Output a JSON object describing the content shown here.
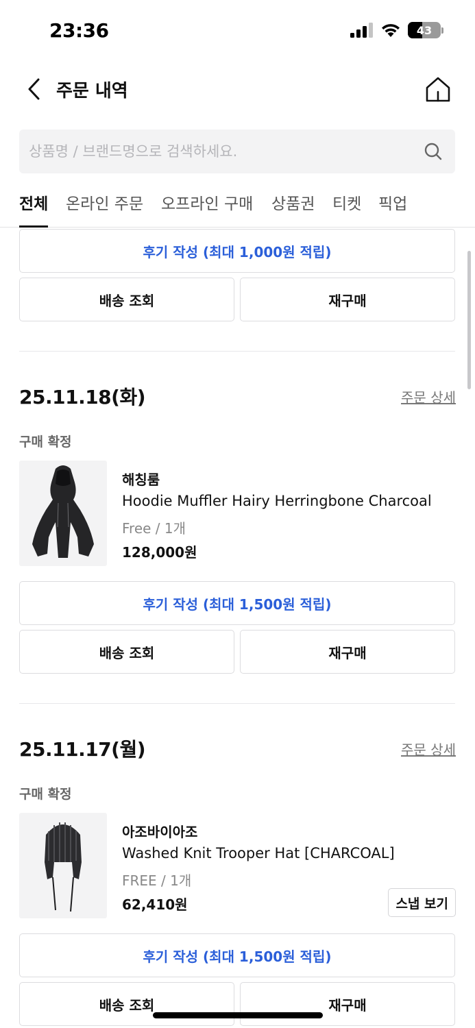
{
  "status_bar": {
    "time": "23:36",
    "battery": "43"
  },
  "header": {
    "title": "주문 내역"
  },
  "search": {
    "placeholder": "상품명 / 브랜드명으로 검색하세요."
  },
  "tabs": [
    {
      "label": "전체",
      "active": true
    },
    {
      "label": "온라인 주문",
      "active": false
    },
    {
      "label": "오프라인 구매",
      "active": false
    },
    {
      "label": "상품권",
      "active": false
    },
    {
      "label": "티켓",
      "active": false
    },
    {
      "label": "픽업",
      "active": false
    }
  ],
  "top_partial": {
    "review_label": "후기 작성 (최대 1,000원 적립)",
    "delivery_label": "배송 조회",
    "rebuy_label": "재구매"
  },
  "orders": [
    {
      "date": "25.11.18(화)",
      "detail_link": "주문 상세",
      "status": "구매 확정",
      "brand": "해칭룸",
      "product_name": "Hoodie Muffler Hairy Herringbone Charcoal",
      "option": "Free / 1개",
      "price": "128,000원",
      "review_label": "후기 작성 (최대 1,500원 적립)",
      "delivery_label": "배송 조회",
      "rebuy_label": "재구매"
    },
    {
      "date": "25.11.17(월)",
      "detail_link": "주문 상세",
      "status": "구매 확정",
      "brand": "아조바이아조",
      "product_name": "Washed Knit Trooper Hat [CHARCOAL]",
      "option": "FREE / 1개",
      "price": "62,410원",
      "snap_label": "스냅 보기",
      "review_label": "후기 작성 (최대 1,500원 적립)",
      "delivery_label": "배송 조회",
      "rebuy_label": "재구매"
    }
  ],
  "colors": {
    "accent_blue": "#2b5fd9",
    "border": "#dcdcdf",
    "thumb_bg": "#f3f3f4"
  }
}
